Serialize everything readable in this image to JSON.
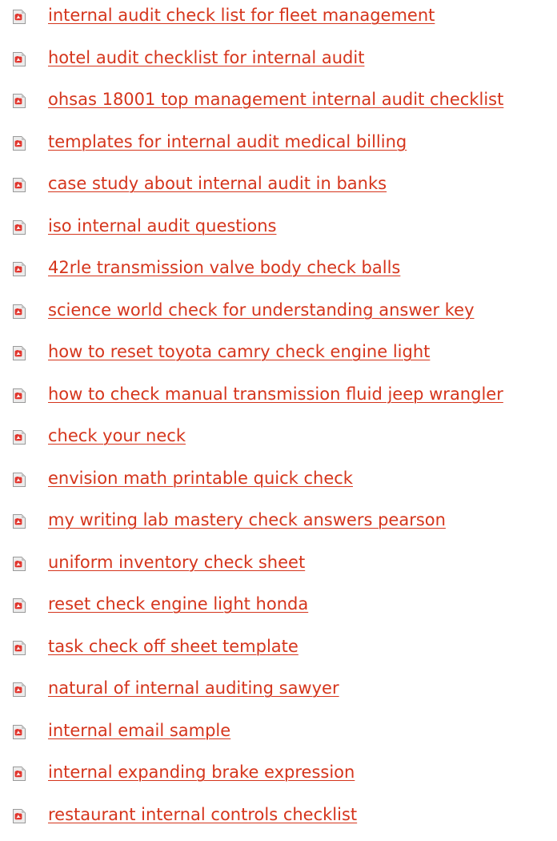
{
  "icon": {
    "name": "pdf-file-icon",
    "page_color": "#ececec",
    "fold_color": "#c4c4c4",
    "logo_color": "#e0241b",
    "border_color": "#9a9a9a"
  },
  "link_color": "#d5351c",
  "links": [
    {
      "label": "internal audit check list for fleet management"
    },
    {
      "label": "hotel audit checklist for internal audit"
    },
    {
      "label": "ohsas 18001 top management internal audit checklist"
    },
    {
      "label": "templates for internal audit medical billing"
    },
    {
      "label": "case study about internal audit in banks"
    },
    {
      "label": "iso internal audit questions"
    },
    {
      "label": "42rle transmission valve body check balls"
    },
    {
      "label": "science world check for understanding answer key"
    },
    {
      "label": "how to reset toyota camry check engine light"
    },
    {
      "label": "how to check manual transmission fluid jeep wrangler"
    },
    {
      "label": "check your neck"
    },
    {
      "label": "envision math printable quick check"
    },
    {
      "label": "my writing lab mastery check answers pearson"
    },
    {
      "label": "uniform inventory check sheet"
    },
    {
      "label": "reset check engine light honda"
    },
    {
      "label": "task check off sheet template"
    },
    {
      "label": "natural of internal auditing sawyer"
    },
    {
      "label": "internal email sample"
    },
    {
      "label": "internal expanding brake expression"
    },
    {
      "label": "restaurant internal controls checklist"
    }
  ]
}
